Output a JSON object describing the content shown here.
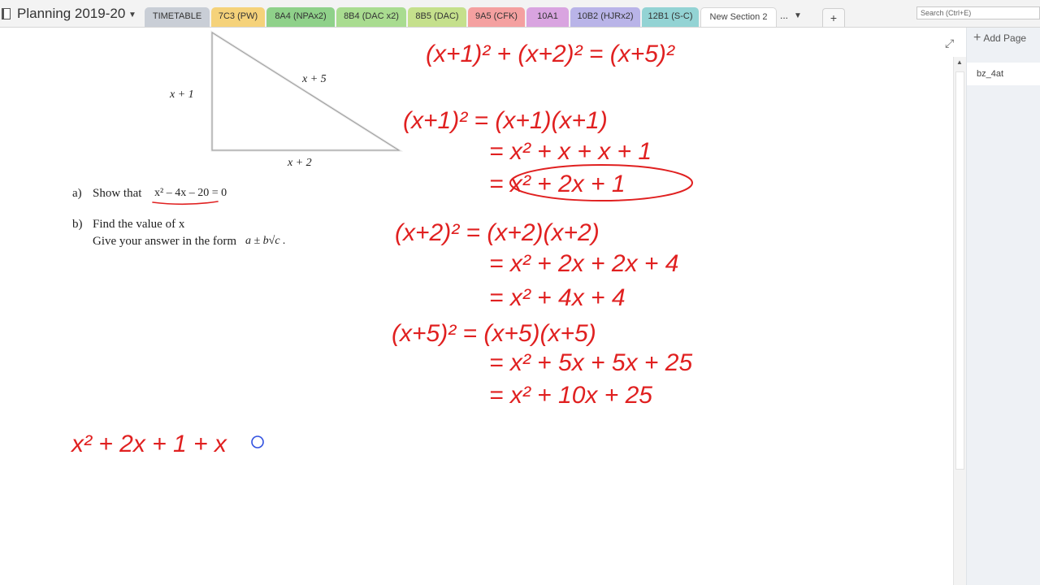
{
  "notebook": {
    "title": "Planning 2019-20"
  },
  "tabs": [
    {
      "label": "TIMETABLE",
      "color": "#c9ced6"
    },
    {
      "label": "7C3 (PW)",
      "color": "#f5d27a"
    },
    {
      "label": "8A4 (NPAx2)",
      "color": "#8fd18a"
    },
    {
      "label": "8B4 (DAC x2)",
      "color": "#a9dc90"
    },
    {
      "label": "8B5 (DAC)",
      "color": "#c5e08c"
    },
    {
      "label": "9A5 (CFK)",
      "color": "#f4a0a0"
    },
    {
      "label": "10A1",
      "color": "#d9a4e0"
    },
    {
      "label": "10B2 (HJRx2)",
      "color": "#b9b4e8"
    },
    {
      "label": "12B1 (S-C)",
      "color": "#93d3d4"
    },
    {
      "label": "New Section 2",
      "color": "#ffffff"
    }
  ],
  "more_tabs_label": "...",
  "add_section_label": "+",
  "search": {
    "placeholder": "Search (Ctrl+E)"
  },
  "page_list": {
    "add_page_label": "Add Page",
    "pages": [
      "bz_4at"
    ]
  },
  "question": {
    "triangle_labels": {
      "left": "x + 1",
      "hyp": "x + 5",
      "bottom": "x + 2"
    },
    "part_a": {
      "label": "a)",
      "text": "Show that",
      "equation": "x² – 4x – 20 = 0"
    },
    "part_b": {
      "label": "b)",
      "line1": "Find the value of x",
      "line2": "Give your answer in the form",
      "form": "a ± b√c ."
    }
  },
  "ink": {
    "color": "#e02020",
    "lines": [
      "(x+1)² + (x+2)² = (x+5)²",
      "(x+1)² = (x+1)(x+1)",
      "= x² + x + x + 1",
      "= x² + 2x + 1",
      "(x+2)² = (x+2)(x+2)",
      "= x² + 2x + 2x + 4",
      "= x² + 4x + 4",
      "(x+5)² = (x+5)(x+5)",
      "= x² + 5x + 5x + 25",
      "= x² + 10x + 25",
      "x² + 2x + 1 + x"
    ]
  }
}
